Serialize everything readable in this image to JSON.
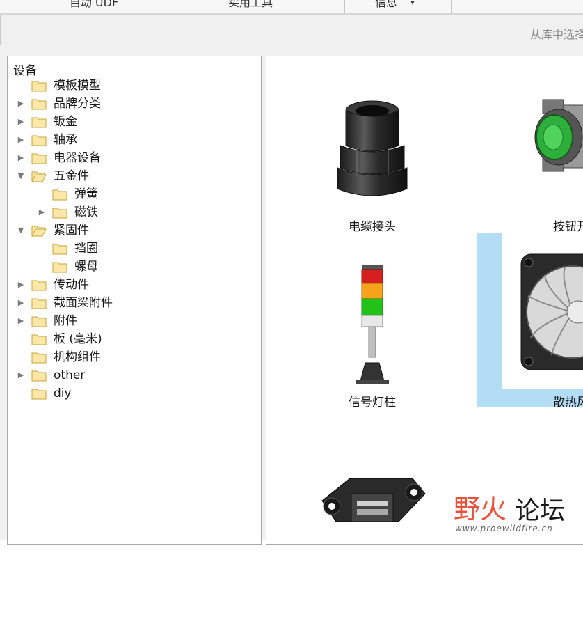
{
  "menubar": {
    "items": [
      "自动 UDF",
      "实用工具",
      "信息"
    ],
    "info_dropdown_caret": "▾"
  },
  "toolbar": {
    "hint_text": "从库中选择"
  },
  "tree": {
    "root_label": "设备",
    "items": [
      {
        "label": "模板模型",
        "level": 1,
        "toggle": "",
        "open": false
      },
      {
        "label": "品牌分类",
        "level": 1,
        "toggle": "▶",
        "open": false
      },
      {
        "label": "钣金",
        "level": 1,
        "toggle": "▶",
        "open": false
      },
      {
        "label": "轴承",
        "level": 1,
        "toggle": "▶",
        "open": false
      },
      {
        "label": "电器设备",
        "level": 1,
        "toggle": "▶",
        "open": false
      },
      {
        "label": "五金件",
        "level": 1,
        "toggle": "▼",
        "open": true
      },
      {
        "label": "弹簧",
        "level": 2,
        "toggle": "",
        "open": false
      },
      {
        "label": "磁铁",
        "level": 2,
        "toggle": "▶",
        "open": false
      },
      {
        "label": "紧固件",
        "level": 1,
        "toggle": "▼",
        "open": true
      },
      {
        "label": "挡圈",
        "level": 2,
        "toggle": "",
        "open": false
      },
      {
        "label": "螺母",
        "level": 2,
        "toggle": "",
        "open": false
      },
      {
        "label": "传动件",
        "level": 1,
        "toggle": "▶",
        "open": false
      },
      {
        "label": "截面梁附件",
        "level": 1,
        "toggle": "▶",
        "open": false
      },
      {
        "label": "附件",
        "level": 1,
        "toggle": "▶",
        "open": false
      },
      {
        "label": "板 (毫米)",
        "level": 1,
        "toggle": "",
        "open": false
      },
      {
        "label": "机构组件",
        "level": 1,
        "toggle": "",
        "open": false
      },
      {
        "label": "other",
        "level": 1,
        "toggle": "▶",
        "open": false
      },
      {
        "label": "diy",
        "level": 1,
        "toggle": "",
        "open": false
      }
    ]
  },
  "gallery": {
    "items": [
      {
        "label": "电缆接头",
        "icon": "cable-gland-icon",
        "selected": false
      },
      {
        "label": "按钮开关",
        "icon": "push-button-icon",
        "selected": false
      },
      {
        "label": "信号灯柱",
        "icon": "signal-tower-icon",
        "selected": false
      },
      {
        "label": "散热风扇",
        "icon": "cooling-fan-icon",
        "selected": true
      },
      {
        "label": "",
        "icon": "connector-icon",
        "selected": false
      }
    ]
  },
  "watermark": {
    "brand_part1": "野火",
    "brand_part2": "论坛",
    "url": "www.proewildfire.cn"
  },
  "colors": {
    "selection": "#b3dcf5",
    "folder_fill": "#fbe7a8",
    "folder_stroke": "#c9a43a",
    "watermark_red": "#e8523a"
  }
}
